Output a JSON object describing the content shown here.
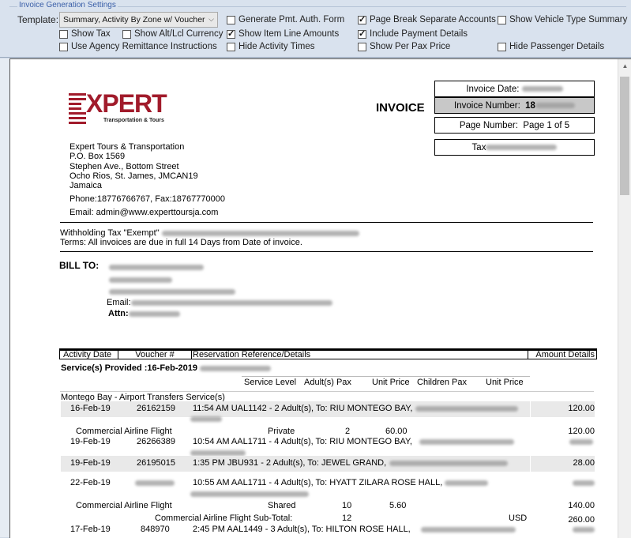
{
  "settings": {
    "group_title": "Invoice Generation Settings",
    "template_label": "Template:",
    "template_value": "Summary, Activity By Zone w/ Voucher",
    "options": [
      {
        "label": "Generate Pmt. Auth. Form",
        "checked": false
      },
      {
        "label": "Page Break Separate Accounts",
        "checked": true
      },
      {
        "label": "Show Vehicle Type Summary",
        "checked": false
      },
      {
        "label": "Show Tax",
        "checked": false
      },
      {
        "label": "Show Alt/Lcl Currency",
        "checked": false
      },
      {
        "label": "Show Item Line Amounts",
        "checked": true
      },
      {
        "label": "Include Payment Details",
        "checked": true
      },
      {
        "label": "Use Agency Remittance Instructions",
        "checked": false
      },
      {
        "label": "Hide Activity Times",
        "checked": false
      },
      {
        "label": "Show Per Pax Price",
        "checked": false
      },
      {
        "label": "Hide Passenger Details",
        "checked": false
      }
    ]
  },
  "invoice": {
    "logo_text": "XPERT",
    "logo_sub": "Transportation & Tours",
    "title": "INVOICE",
    "date_label": "Invoice Date:",
    "number_label": "Invoice Number:",
    "number_value": "18",
    "page_label": "Page Number:",
    "page_value": "Page 1 of 5",
    "tax_label": "Tax",
    "company": {
      "name": "Expert Tours & Transportation",
      "po": "P.O. Box 1569",
      "street": "Stephen Ave., Bottom Street",
      "city": "Ocho Rios, St. James, JMCAN19",
      "country": "Jamaica",
      "phone": "Phone:18776766767, Fax:18767770000",
      "email": "Email: admin@www.experttoursja.com"
    },
    "withholding": "Withholding Tax \"Exempt\"",
    "terms": "Terms: All invoices are due in full 14 Days from Date of invoice.",
    "bill_to": "BILL TO:",
    "email_label": "Email:",
    "attn_label": "Attn:",
    "columns": [
      "Activity Date",
      "Voucher #",
      "Reservation Reference/Details",
      "Amount Details"
    ],
    "services_label": "Service(s) Provided :16-Feb-2019",
    "sub_headers": [
      "Service Level",
      "Adult(s) Pax",
      "Unit Price",
      "Children Pax",
      "Unit Price"
    ],
    "zone": "Montego Bay - Airport Transfers Service(s)",
    "rows": [
      {
        "date": "16-Feb-19",
        "voucher": "26162159",
        "details": "11:54 AM  UAL1142 - 2 Adult(s),   To: RIU MONTEGO BAY,",
        "amount": "120.00"
      },
      {
        "date": "19-Feb-19",
        "voucher": "26266389",
        "details": "10:54 AM  AAL1711 - 4 Adult(s),   To: RIU MONTEGO BAY,",
        "amount": ""
      },
      {
        "date": "19-Feb-19",
        "voucher": "26195015",
        "details": "1:35 PM  JBU931 - 2 Adult(s),   To: JEWEL GRAND,",
        "amount": "28.00"
      },
      {
        "date": "22-Feb-19",
        "voucher": "",
        "details": "10:55 AM  AAL1711 - 4 Adult(s),   To: HYATT ZILARA ROSE HALL,",
        "amount": ""
      },
      {
        "date": "17-Feb-19",
        "voucher": "848970",
        "details": "2:45 PM  AAL1449 - 3 Adult(s),   To: HILTON ROSE HALL,",
        "amount": ""
      }
    ],
    "summary1": {
      "label": "Commercial Airline Flight",
      "level": "Private",
      "pax": "2",
      "price": "60.00",
      "amount": "120.00"
    },
    "summary2": {
      "label": "Commercial Airline Flight",
      "level": "Shared",
      "pax": "10",
      "price": "5.60",
      "amount": "140.00"
    },
    "subtotal": {
      "label": "Commercial Airline Flight Sub-Total:",
      "pax": "12",
      "currency": "USD",
      "amount": "260.00"
    }
  }
}
